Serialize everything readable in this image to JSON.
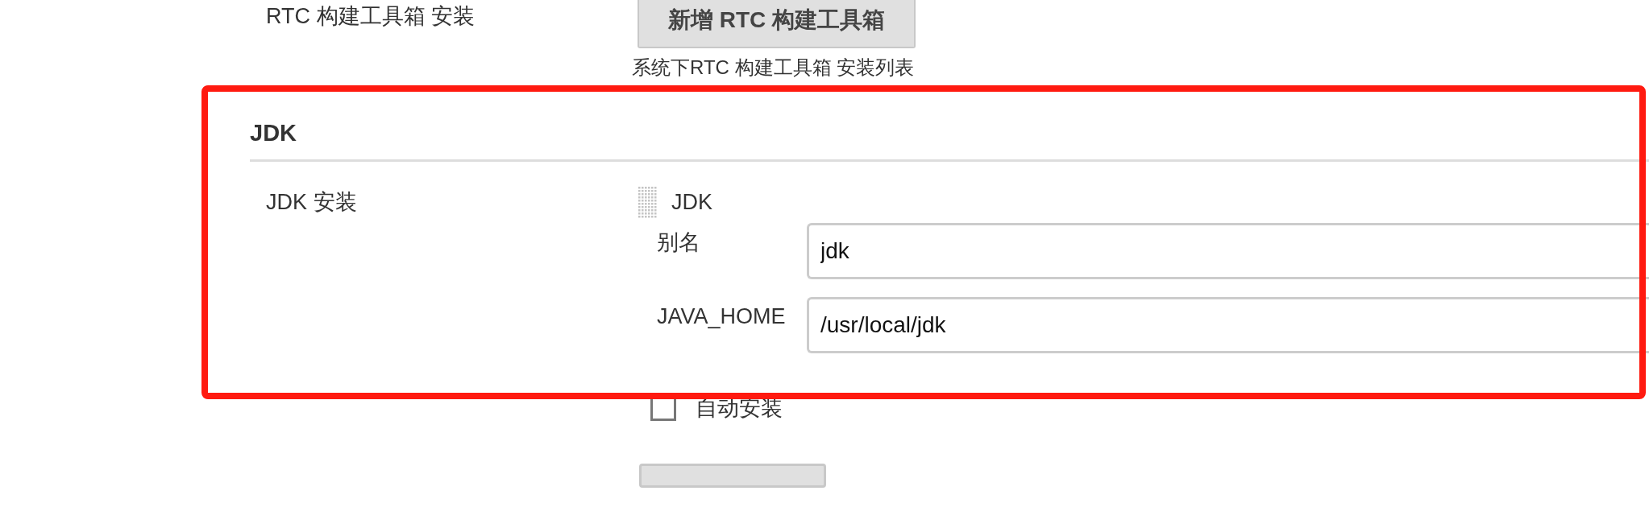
{
  "previous_section": {
    "label": "RTC 构建工具箱 安装",
    "button": "新增 RTC 构建工具箱",
    "help": "系统下RTC 构建工具箱 安装列表"
  },
  "section": {
    "title": "JDK",
    "label": "JDK 安装",
    "installation": {
      "title": "JDK",
      "fields": [
        {
          "label": "别名",
          "value": "jdk"
        },
        {
          "label": "JAVA_HOME",
          "value": "/usr/local/jdk"
        }
      ],
      "auto_install": {
        "label": "自动安装",
        "checked": false
      }
    }
  },
  "annotation": {
    "kind": "highlight",
    "color": "#ff1a10"
  }
}
